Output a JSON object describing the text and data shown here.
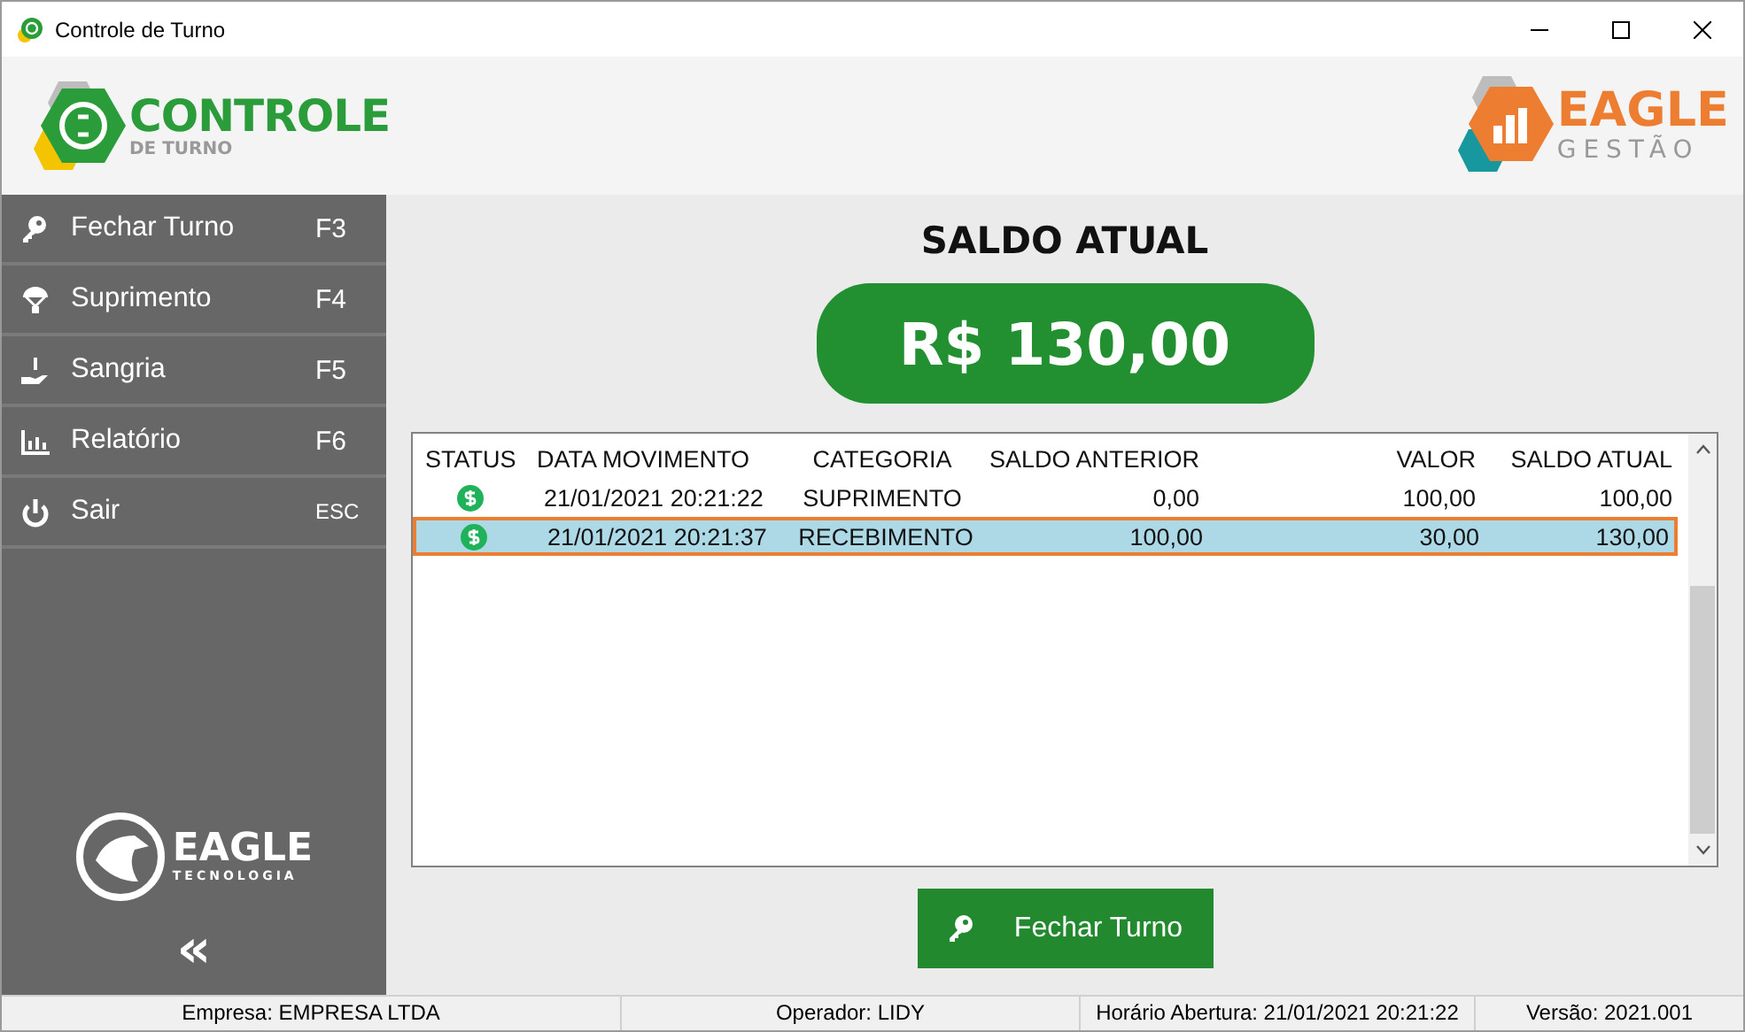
{
  "window": {
    "title": "Controle de Turno"
  },
  "header": {
    "logo_title": "CONTROLE",
    "logo_subtitle": "DE TURNO",
    "brand_title": "EAGLE",
    "brand_subtitle": "GESTÃO"
  },
  "sidebar": {
    "items": [
      {
        "label": "Fechar Turno",
        "shortcut": "F3"
      },
      {
        "label": "Suprimento",
        "shortcut": "F4"
      },
      {
        "label": "Sangria",
        "shortcut": "F5"
      },
      {
        "label": "Relatório",
        "shortcut": "F6"
      },
      {
        "label": "Sair",
        "shortcut": "ESC"
      }
    ],
    "logo_title": "EAGLE",
    "logo_subtitle": "TECNOLOGIA",
    "collapse": "«"
  },
  "balance": {
    "title": "SALDO ATUAL",
    "amount": "R$ 130,00"
  },
  "table": {
    "columns": [
      "STATUS",
      "DATA MOVIMENTO",
      "CATEGORIA",
      "SALDO ANTERIOR",
      "VALOR",
      "SALDO ATUAL"
    ],
    "rows": [
      {
        "selected": false,
        "cells": [
          "",
          "21/01/2021 20:21:22",
          "SUPRIMENTO",
          "0,00",
          "100,00",
          "100,00"
        ]
      },
      {
        "selected": true,
        "cells": [
          "",
          "21/01/2021 20:21:37",
          "RECEBIMENTO",
          "100,00",
          "30,00",
          "130,00"
        ]
      }
    ]
  },
  "action_button": {
    "label": "Fechar Turno"
  },
  "status_bar": [
    "Empresa: EMPRESA LTDA",
    "Operador: LIDY",
    "Horário Abertura: 21/01/2021 20:21:22",
    "Versão: 2021.001"
  ]
}
